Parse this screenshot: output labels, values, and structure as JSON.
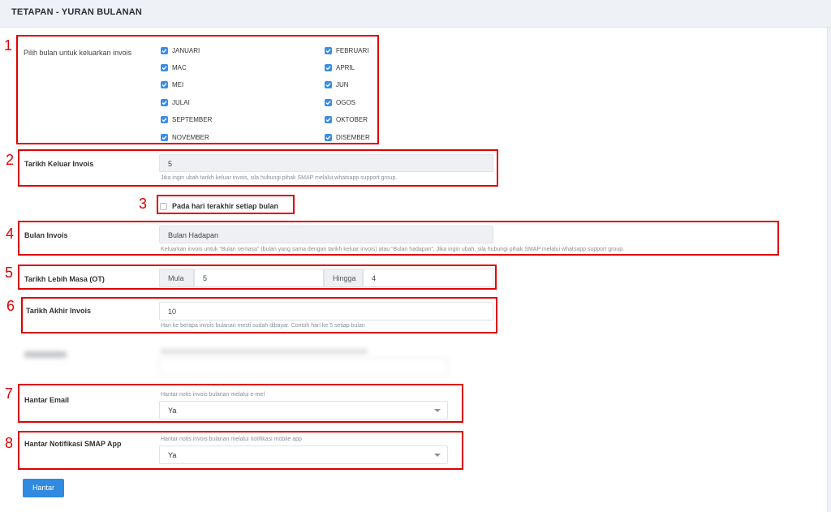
{
  "header": {
    "title": "TETAPAN - YURAN BULANAN"
  },
  "months": {
    "label": "Pilih bulan untuk keluarkan invois",
    "left": [
      "JANUARI",
      "MAC",
      "MEI",
      "JULAI",
      "SEPTEMBER",
      "NOVEMBER"
    ],
    "right": [
      "FEBRUARI",
      "APRIL",
      "JUN",
      "OGOS",
      "OKTOBER",
      "DISEMBER"
    ],
    "all_checked": true
  },
  "tarikh_keluar": {
    "label": "Tarikh Keluar Invois",
    "value": "5",
    "help": "Jika ingin ubah tarikh keluar invois, sila hubungi pihak SMAP melalui whatsapp support group."
  },
  "last_day": {
    "label": "Pada hari terakhir setiap bulan",
    "checked": false
  },
  "bulan_invois": {
    "label": "Bulan Invois",
    "value": "Bulan Hadapan",
    "help": "Keluarkan invois untuk “Bulan semasa” (bulan yang sama dengan tarikh keluar invois) atau “Bulan hadapan”. Jika ingin ubah, sila hubungi pihak SMAP melalui whatsapp support group."
  },
  "lebih_masa": {
    "label": "Tarikh Lebih Masa (OT)",
    "mula_label": "Mula",
    "mula_value": "5",
    "hingga_label": "Hingga",
    "hingga_value": "4"
  },
  "akhir_invois": {
    "label": "Tarikh Akhir Invois",
    "value": "10",
    "help": "Hari ke berapa invois bulanan mesti sudah dibayar. Contoh hari ke 5 setiap bulan"
  },
  "email": {
    "label": "Hantar Email",
    "help": "Hantar notis invois bulanan melalui e-mel",
    "value": "Ya"
  },
  "app": {
    "label": "Hantar Notifikasi SMAP App",
    "help": "Hantar notis invois bulanan melalui notifikasi mobile app",
    "value": "Ya"
  },
  "submit_label": "Hantar",
  "annotations": [
    "1",
    "2",
    "3",
    "4",
    "5",
    "6",
    "7",
    "8"
  ],
  "colors": {
    "accent": "#2f8ae0",
    "annotation": "#e00000"
  }
}
